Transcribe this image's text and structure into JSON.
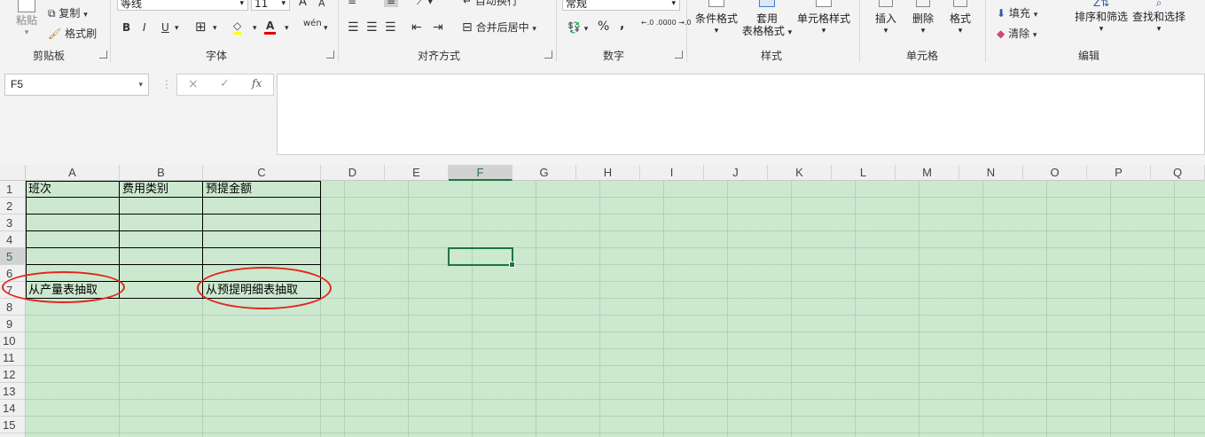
{
  "ribbon": {
    "clipboard": {
      "paste_label": "粘贴",
      "copy_label": "复制",
      "format_painter_label": "格式刷",
      "group_label": "剪贴板"
    },
    "font": {
      "font_name": "等线",
      "font_size": "11",
      "bold": "B",
      "italic": "I",
      "underline": "U",
      "group_label": "字体",
      "grow_font": "A",
      "shrink_font": "A",
      "phonetic": "wén"
    },
    "alignment": {
      "wrap_text_label": "自动换行",
      "merge_center_label": "合并后居中",
      "group_label": "对齐方式"
    },
    "number": {
      "format_value": "常规",
      "percent": "%",
      "comma": ",",
      "inc_decimal": "←.0 .00",
      "dec_decimal": ".00 →.0",
      "group_label": "数字"
    },
    "styles": {
      "conditional_format_label": "条件格式",
      "format_table_label_1": "套用",
      "format_table_label_2": "表格格式",
      "cell_styles_label": "单元格样式",
      "group_label": "样式"
    },
    "cells": {
      "insert_label": "插入",
      "delete_label": "删除",
      "format_label": "格式",
      "group_label": "单元格"
    },
    "editing": {
      "fill_label": "填充",
      "clear_label": "清除",
      "sort_filter_label": "排序和筛选",
      "find_select_label": "查找和选择",
      "group_label": "编辑"
    }
  },
  "formula_bar": {
    "name_box": "F5",
    "cancel_icon": "×",
    "enter_icon": "✓",
    "fx_label": "fx",
    "formula_value": ""
  },
  "columns": [
    "A",
    "B",
    "C",
    "D",
    "E",
    "F",
    "G",
    "H",
    "I",
    "J",
    "K",
    "L",
    "M",
    "N",
    "O",
    "P",
    "Q"
  ],
  "rows": [
    "1",
    "2",
    "3",
    "4",
    "5",
    "6",
    "7",
    "8",
    "9",
    "10",
    "11",
    "12",
    "13",
    "14",
    "15"
  ],
  "selected_cell": "F5",
  "cells": {
    "A1": "班次",
    "B1": "费用类别",
    "C1": "预提金额",
    "A7": "从产量表抽取",
    "C7": "从预提明细表抽取"
  },
  "colors": {
    "grid_bg": "#cce8cf",
    "selection": "#217346",
    "annotation": "#e1261c"
  }
}
